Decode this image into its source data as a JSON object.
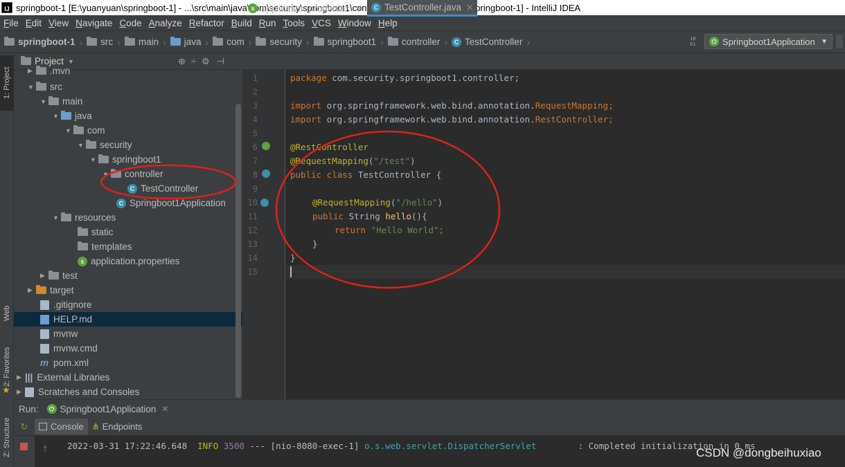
{
  "window": {
    "title": "springboot-1 [E:\\yuanyuan\\springboot-1] - ...\\src\\main\\java\\com\\security\\springboot1\\controller\\TestController.java [springboot-1] - IntelliJ IDEA",
    "app_icon": "IJ"
  },
  "menu": [
    "File",
    "Edit",
    "View",
    "Navigate",
    "Code",
    "Analyze",
    "Refactor",
    "Build",
    "Run",
    "Tools",
    "VCS",
    "Window",
    "Help"
  ],
  "breadcrumbs": [
    "springboot-1",
    "src",
    "main",
    "java",
    "com",
    "security",
    "springboot1",
    "controller",
    "TestController"
  ],
  "run_config": {
    "label": "Springboot1Application"
  },
  "left_strip": {
    "project": "1: Project",
    "web": "Web",
    "favorites": "2: Favorites",
    "structure": "Z: Structure"
  },
  "project_panel": {
    "title": "Project",
    "tree": [
      {
        "label": ".mvn"
      },
      {
        "label": "src"
      },
      {
        "label": "main"
      },
      {
        "label": "java"
      },
      {
        "label": "com"
      },
      {
        "label": "security"
      },
      {
        "label": "springboot1"
      },
      {
        "label": "controller"
      },
      {
        "label": "TestController"
      },
      {
        "label": "Springboot1Application"
      },
      {
        "label": "resources"
      },
      {
        "label": "static"
      },
      {
        "label": "templates"
      },
      {
        "label": "application.properties"
      },
      {
        "label": "test"
      },
      {
        "label": "target"
      },
      {
        "label": ".gitignore"
      },
      {
        "label": "HELP.md"
      },
      {
        "label": "mvnw"
      },
      {
        "label": "mvnw.cmd"
      },
      {
        "label": "pom.xml"
      },
      {
        "label": "External Libraries"
      },
      {
        "label": "Scratches and Consoles"
      }
    ]
  },
  "editor": {
    "tabs": [
      {
        "label": "application.properties"
      },
      {
        "label": "TestController.java"
      }
    ],
    "line_numbers": [
      "1",
      "2",
      "3",
      "4",
      "5",
      "6",
      "7",
      "8",
      "9",
      "10",
      "11",
      "12",
      "13",
      "14",
      "15"
    ],
    "code": {
      "l1_kw": "package",
      "l1_rest": " com.security.springboot1.controller;",
      "l3_kw": "import",
      "l3_pkg": " org.springframework.web.bind.annotation.",
      "l3_cls": "RequestMapping",
      "l3_end": ";",
      "l4_kw": "import",
      "l4_pkg": " org.springframework.web.bind.annotation.",
      "l4_cls": "RestController",
      "l4_end": ";",
      "l6_ann": "@RestController",
      "l7_ann": "@RequestMapping",
      "l7_open": "(",
      "l7_str": "\"/test\"",
      "l7_close": ")",
      "l8_kw": "public class",
      "l8_rest": " TestController {",
      "l10_ann": "@RequestMapping",
      "l10_open": "(",
      "l10_str": "\"/hello\"",
      "l10_close": ")",
      "l11_kw": "public",
      "l11_type": " String ",
      "l11_fn": "hello",
      "l11_rest": "(){",
      "l12_kw": "return",
      "l12_str": " \"Hello World\"",
      "l12_end": ";",
      "l13": "}",
      "l14": "}"
    }
  },
  "run_panel": {
    "label": "Run:",
    "config": "Springboot1Application",
    "tabs": [
      "Console",
      "Endpoints"
    ],
    "log": {
      "timestamp": "2022-03-31 17:22:46.648",
      "level": "INFO",
      "pid": "3500",
      "sep": "---",
      "thread": "[nio-8080-exec-1]",
      "logger": "o.s.web.servlet.DispatcherServlet",
      "message": ": Completed initialization in 0 ms"
    }
  },
  "watermark": "CSDN @dongbeihuxiao",
  "colors": {
    "annotation_ring": "#e0201a",
    "keyword": "#cc7832",
    "string": "#6a8759",
    "annotation": "#bbb529"
  }
}
